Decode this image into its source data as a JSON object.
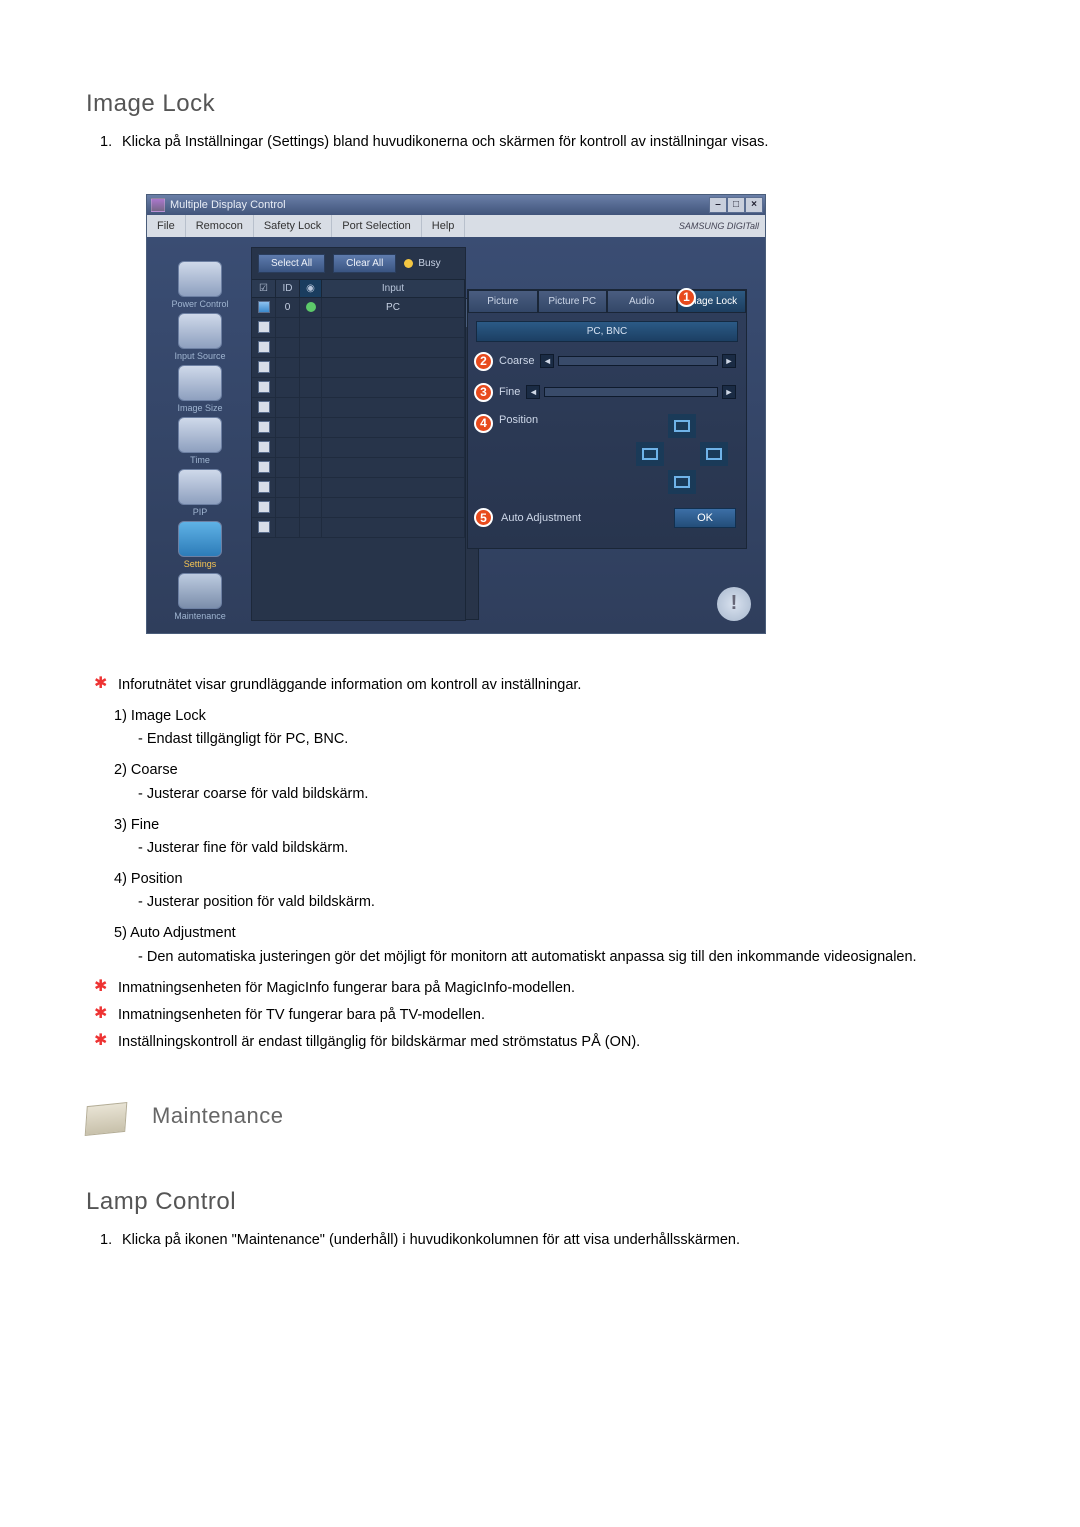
{
  "section1_title": "Image Lock",
  "section1_step1": "Klicka på Inställningar (Settings) bland huvudikonerna och skärmen för kontroll av inställningar visas.",
  "win": {
    "title": "Multiple Display Control",
    "menu": {
      "file": "File",
      "remocon": "Remocon",
      "safety": "Safety Lock",
      "port": "Port Selection",
      "help": "Help"
    },
    "brand": "SAMSUNG DIGITall",
    "nav": {
      "power": "Power Control",
      "input": "Input Source",
      "image": "Image Size",
      "time": "Time",
      "pip": "PIP",
      "settings": "Settings",
      "maintenance": "Maintenance"
    },
    "toolbar": {
      "select_all": "Select All",
      "clear_all": "Clear All",
      "busy": "Busy"
    },
    "grid": {
      "h_id": "ID",
      "h_input": "Input",
      "row0_id": "0",
      "row0_input": "PC"
    },
    "panel": {
      "tab_picture": "Picture",
      "tab_picturepc": "Picture PC",
      "tab_audio": "Audio",
      "tab_imagelock": "Image Lock",
      "hdr": "PC, BNC",
      "coarse": "Coarse",
      "fine": "Fine",
      "position": "Position",
      "autoadj": "Auto Adjustment",
      "ok": "OK"
    }
  },
  "note_intro": "Inforutnätet visar grundläggande information om kontroll av inställningar.",
  "li1_h": "1)  Image Lock",
  "li1_d": "- Endast tillgängligt för PC, BNC.",
  "li2_h": "2)  Coarse",
  "li2_d": "- Justerar coarse för vald bildskärm.",
  "li3_h": "3)  Fine",
  "li3_d": "- Justerar fine för vald bildskärm.",
  "li4_h": "4)  Position",
  "li4_d": "- Justerar position för vald bildskärm.",
  "li5_h": "5)  Auto Adjustment",
  "li5_d": "Den automatiska justeringen gör det möjligt för monitorn att automatiskt anpassa sig till den inkommande videosignalen.",
  "note_magic": "Inmatningsenheten för MagicInfo fungerar bara på MagicInfo-modellen.",
  "note_tv": "Inmatningsenheten för TV fungerar bara på TV-modellen.",
  "note_on": "Inställningskontroll är endast tillgänglig för bildskärmar med strömstatus PÅ (ON).",
  "maintenance_title": "Maintenance",
  "section2_title": "Lamp Control",
  "section2_step1": "Klicka på ikonen \"Maintenance\" (underhåll) i huvudikonkolumnen för att visa underhållsskärmen."
}
